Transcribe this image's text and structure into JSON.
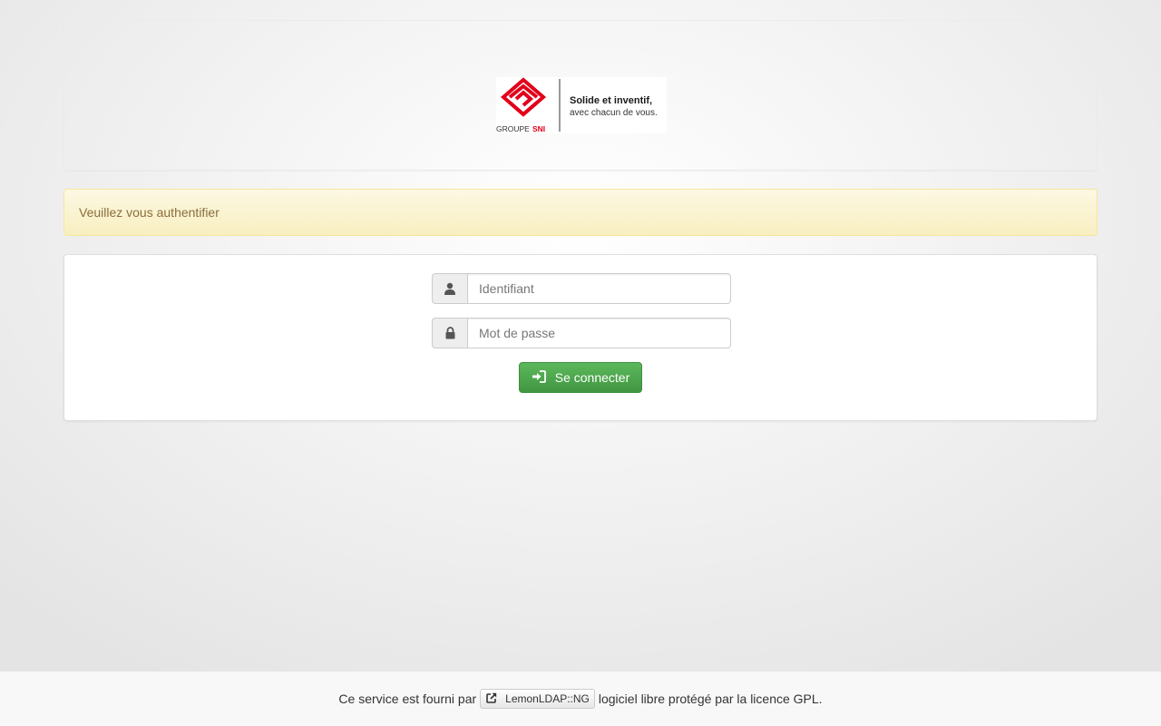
{
  "header": {
    "logo": {
      "brand_prefix": "GROUPE",
      "brand_name": "SNI",
      "tagline_line1": "Solide et inventif,",
      "tagline_line2": "avec chacun de vous."
    }
  },
  "alert": {
    "message": "Veuillez vous authentifier"
  },
  "login_form": {
    "username": {
      "value": "",
      "placeholder": "Identifiant",
      "icon": "user-icon"
    },
    "password": {
      "value": "",
      "placeholder": "Mot de passe",
      "icon": "lock-icon"
    },
    "submit_label": "Se connecter",
    "submit_icon": "sign-in-icon"
  },
  "footer": {
    "prefix": "Ce service est fourni par",
    "link_label": "LemonLDAP::NG",
    "link_icon": "external-link-icon",
    "suffix": "logiciel libre protégé par la licence GPL."
  },
  "colors": {
    "brand_red": "#e2001a",
    "success_green": "#4cae4c",
    "warning_text": "#8a6d3b",
    "warning_bg": "#fcf8e3"
  }
}
